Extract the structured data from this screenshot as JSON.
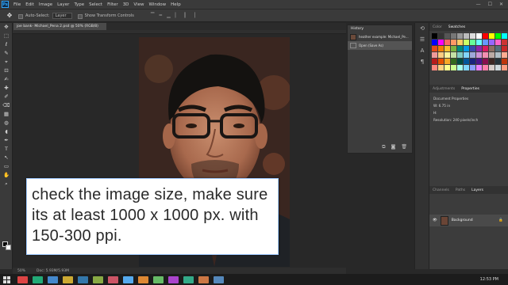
{
  "menubar": {
    "logo": "Ps",
    "items": [
      "File",
      "Edit",
      "Image",
      "Layer",
      "Type",
      "Select",
      "Filter",
      "3D",
      "View",
      "Window",
      "Help"
    ],
    "controls": [
      "—",
      "☐",
      "✕"
    ]
  },
  "options": {
    "auto_select_label": "Auto-Select:",
    "auto_select_value": "Layer",
    "transform_label": "Show Transform Controls"
  },
  "toolbar": {
    "tools": [
      "✥",
      "⬚",
      "ℓ",
      "✎",
      "⌖",
      "⊡",
      "✍",
      "✚",
      "✐",
      "⌫",
      "▦",
      "◍",
      "◖",
      "✒",
      "T",
      "↖",
      "▭",
      "✋",
      "⌕"
    ]
  },
  "document": {
    "tab_label": "joe bank- Michael_Pena 2.psd @ 50% (RGB/8)",
    "status_zoom": "50%",
    "status_doc": "Doc: 5.93M/5.93M"
  },
  "caption": {
    "text": "check the image size, make sure its at least 1000 x 1000 px. with 150-300 ppi."
  },
  "history": {
    "title": "History",
    "rows": [
      {
        "label": "heather example: Michael_Pe..."
      },
      {
        "label": "Open (Save As)"
      }
    ]
  },
  "right_panel": {
    "top_tabs": [
      "Color",
      "Swatches"
    ],
    "props_tabs": [
      "Adjustments",
      "Properties"
    ],
    "props_title": "Document Properties",
    "props_w": "W:  6.75 in",
    "props_h": "H:",
    "props_res": "Resolution: 240 pixels/inch",
    "layers_tabs": [
      "Channels",
      "Paths",
      "Layers"
    ],
    "layer_name": "Background"
  },
  "swatch_colors": [
    "#000000",
    "#333333",
    "#555555",
    "#777777",
    "#999999",
    "#bbbbbb",
    "#dddddd",
    "#ffffff",
    "#ff0000",
    "#ffff00",
    "#00ff00",
    "#00ffff",
    "#0000ff",
    "#ff00ff",
    "#ff6666",
    "#ff9966",
    "#ffcc66",
    "#ccff66",
    "#66ff99",
    "#66ffff",
    "#6699ff",
    "#9966ff",
    "#ff66cc",
    "#cc3333",
    "#e64a19",
    "#f57c00",
    "#fbc02d",
    "#7cb342",
    "#00897b",
    "#039be5",
    "#3949ab",
    "#8e24aa",
    "#d81b60",
    "#8d6e63",
    "#546e7a",
    "#c62828",
    "#ef9a9a",
    "#ffcc80",
    "#fff59d",
    "#c5e1a5",
    "#80cbc4",
    "#81d4fa",
    "#9fa8da",
    "#ce93d8",
    "#f48fb1",
    "#bcaaa4",
    "#b0bec5",
    "#ffab91",
    "#b71c1c",
    "#e65100",
    "#f9a825",
    "#33691e",
    "#004d40",
    "#01579b",
    "#1a237e",
    "#4a148c",
    "#880e4f",
    "#3e2723",
    "#263238",
    "#bf360c",
    "#ff8a80",
    "#ffd180",
    "#ffff8d",
    "#ccff90",
    "#a7ffeb",
    "#80d8ff",
    "#8c9eff",
    "#ea80fc",
    "#ff80ab",
    "#d7ccc8",
    "#cfd8dc",
    "#ff9e80"
  ],
  "taskbar": {
    "icon_colors": [
      "#d44",
      "#2a7",
      "#48c",
      "#ca3",
      "#37a",
      "#8a4",
      "#c56",
      "#5ae",
      "#d83",
      "#6b6",
      "#a4c",
      "#3a8",
      "#c74",
      "#58b"
    ],
    "clock": "12:53 PM"
  }
}
